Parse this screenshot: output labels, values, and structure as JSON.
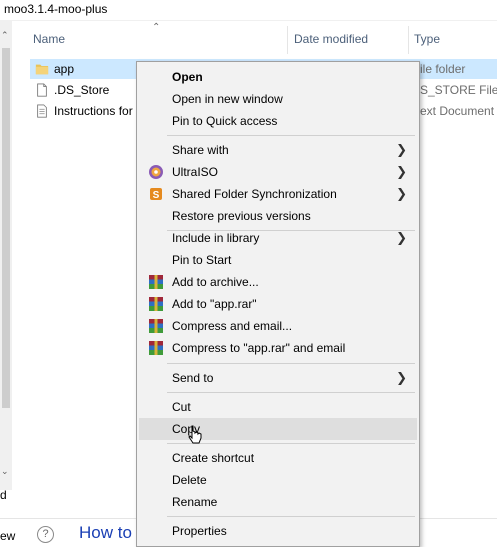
{
  "window": {
    "title": "moo3.1.4-moo-plus"
  },
  "columns": {
    "name": "Name",
    "date_modified": "Date modified",
    "type": "Type"
  },
  "files": [
    {
      "name": "app",
      "type": "ile folder",
      "icon": "folder-icon",
      "selected": true
    },
    {
      "name": ".DS_Store",
      "type": "S_STORE File",
      "icon": "file-icon",
      "selected": false
    },
    {
      "name": "Instructions for",
      "type": "ext Document",
      "icon": "text-file-icon",
      "selected": false
    }
  ],
  "left_panel": {
    "label": "d"
  },
  "bottom": {
    "view_label": "ew",
    "help_icon": "?",
    "link_text": "How to"
  },
  "context_menu": {
    "items": [
      {
        "label": "Open",
        "bold": true
      },
      {
        "label": "Open in new window"
      },
      {
        "label": "Pin to Quick access"
      },
      {
        "label": "Share with",
        "submenu": true
      },
      {
        "label": "UltraISO",
        "submenu": true,
        "icon": "ultraiso-icon"
      },
      {
        "label": "Shared Folder Synchronization",
        "submenu": true,
        "icon": "sync-icon"
      },
      {
        "label": "Restore previous versions"
      },
      {
        "label": "Include in library",
        "submenu": true
      },
      {
        "label": "Pin to Start"
      },
      {
        "label": "Add to archive...",
        "icon": "winrar-icon"
      },
      {
        "label": "Add to \"app.rar\"",
        "icon": "winrar-icon"
      },
      {
        "label": "Compress and email...",
        "icon": "winrar-icon"
      },
      {
        "label": "Compress to \"app.rar\" and email",
        "icon": "winrar-icon"
      },
      {
        "label": "Send to",
        "submenu": true
      },
      {
        "label": "Cut"
      },
      {
        "label": "Copy",
        "hover": true
      },
      {
        "label": "Create shortcut"
      },
      {
        "label": "Delete"
      },
      {
        "label": "Rename"
      },
      {
        "label": "Properties"
      }
    ]
  },
  "colors": {
    "selection": "#cce8ff",
    "menu_background": "#f2f2f2",
    "menu_hover": "#dedede",
    "link": "#1a3fb4"
  }
}
